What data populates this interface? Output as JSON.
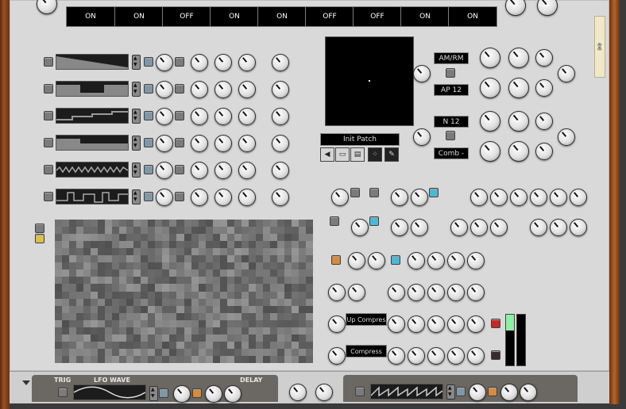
{
  "switches": [
    "ON",
    "ON",
    "OFF",
    "ON",
    "ON",
    "OFF",
    "OFF",
    "ON",
    "ON"
  ],
  "filter_modes": {
    "mode1": "AM/RM",
    "mode2": "AP 12",
    "mode3": "N 12",
    "mode4": "Comb -"
  },
  "patch": {
    "name": "Init Patch"
  },
  "dynamics": {
    "label1": "Up Compres",
    "label2": "Compress"
  },
  "bottom": {
    "trig_label": "TRIG",
    "lfo_wave_label": "LFO WAVE",
    "delay_label": "DELAY"
  },
  "side_tab": {
    "label": "ee"
  },
  "meters": {
    "left_level": 0.32,
    "right_level": 0.0
  },
  "colors": {
    "panel": "#d9d9d9",
    "wood": "#9a4f20",
    "meter_green": "#8ef0a0"
  }
}
